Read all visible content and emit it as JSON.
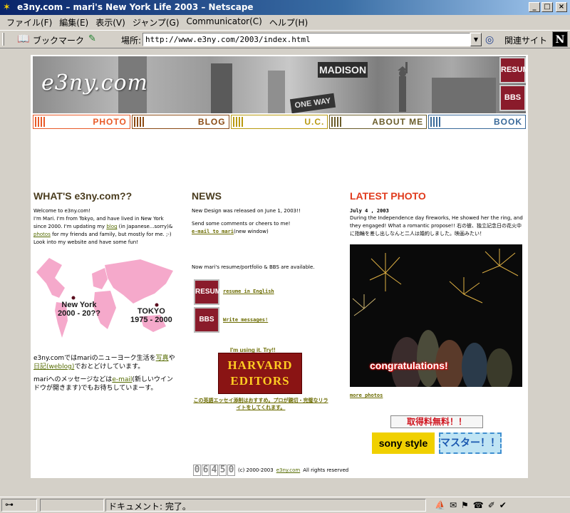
{
  "window": {
    "title": "e3ny.com – mari's New York Life 2003 – Netscape",
    "app_icon": "netscape-icon",
    "buttons": {
      "minimize": "_",
      "maximize": "□",
      "close": "×"
    }
  },
  "menu": [
    "ファイル(F)",
    "編集(E)",
    "表示(V)",
    "ジャンプ(G)",
    "Communicator(C)",
    "ヘルプ(H)"
  ],
  "toolbar": {
    "bookmark_label": "ブックマーク",
    "location_label": "場所:",
    "url": "http://www.e3ny.com/2003/index.html",
    "related_label": "関連サイト",
    "brand_logo": "N"
  },
  "header": {
    "site_logo": "e3ny.com",
    "sign_madison": "MADISON",
    "sign_oneway": "ONE WAY",
    "resume_btn": "RESUME",
    "bbs_btn": "BBS"
  },
  "nav": [
    {
      "label": "PHOTO",
      "color": "#e85a28"
    },
    {
      "label": "BLOG",
      "color": "#8a4a14"
    },
    {
      "label": "U.C.",
      "color": "#b89a10"
    },
    {
      "label": "ABOUT ME",
      "color": "#6a5c2a"
    },
    {
      "label": "BOOK",
      "color": "#3a6a9a"
    }
  ],
  "left": {
    "title": "WHAT'S e3ny.com??",
    "welcome_1": "Welcome to e3ny.com!",
    "welcome_2": "I'm Mari. I'm from Tokyo, and have lived in New York since 2000. I'm updating my",
    "blog_link": "blog",
    "welcome_3": "(in Japanese...sorry)&",
    "photos_link": "photos",
    "welcome_4": "for my friends and family, but mostly for me. ;-)",
    "welcome_5": "Look into my website and have some fun!",
    "map_ny_label": "New York",
    "map_ny_years": "2000 - 20??",
    "map_tokyo_label": "TOKYO",
    "map_tokyo_years": "1975 - 2000",
    "jp_1a": "e3ny.comではmariのニューヨーク生活を",
    "jp_photo_link": "写真",
    "jp_1b": "や",
    "jp_diary_link": "日記(weblog)",
    "jp_1c": "でおとどけしています。",
    "jp_2a": "mariへのメッセージなどは",
    "jp_email_link": "e-mail",
    "jp_2b": "(新しいウインドウが開きます)でもお待ちしていまーす。"
  },
  "middle": {
    "title": "NEWS",
    "news_1": "New Design was released on June 1, 2003!!",
    "news_2": "Send some comments or cheers to me!",
    "email_link": "e-mail to mari",
    "email_note": "(new window)",
    "news_3": "Now mari's resume/portfolio & BBS are available.",
    "resume_btn": "RESUME",
    "resume_link": "resume in English",
    "bbs_btn": "BBS",
    "bbs_link": "Write messages!",
    "harvard_caption": "I'm using it. Try!!",
    "harvard_line1": "HARVARD",
    "harvard_line2": "EDITORS",
    "harvard_note": "この英語エッセイ添削はおすすめ。プロが親切・完璧なリライトをしてくれます。"
  },
  "right": {
    "title": "LATEST PHOTO",
    "date": "July 4 , 2003",
    "desc": "During the Independence day fireworks, He showed her the ring, and they engaged! What a romantic propose!! 右の彼、独立記念日の花火中に指輪を差し出しなんと二人は婚約しました。映画みたい！",
    "photo_caption": "congratulations!",
    "more_link": "more photos",
    "free_btn": "取得料無料！！",
    "sony_btn": "sony style",
    "master_btn": "マスター！！"
  },
  "footer": {
    "counter": [
      "0",
      "6",
      "4",
      "5",
      "0"
    ],
    "copyright": "(c) 2000-2003",
    "site_link": "e3ny.com",
    "rights": "All rights reserved"
  },
  "status": {
    "text": "ドキュメント: 完了。"
  }
}
